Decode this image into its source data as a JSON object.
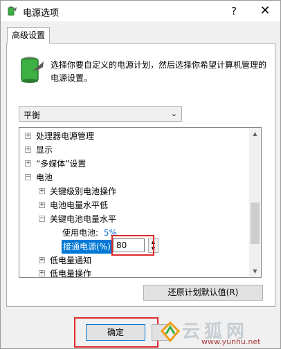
{
  "window": {
    "title": "电源选项",
    "help_label": "?",
    "close_label": "✕"
  },
  "tab": {
    "label": "高级设置"
  },
  "description": "选择你要自定义的电源计划，然后选择你希望计算机管理的电源设置。",
  "plan_select": {
    "value": "平衡"
  },
  "tree": {
    "items": [
      {
        "expander": "+",
        "label": "处理器电源管理"
      },
      {
        "expander": "+",
        "label": "显示"
      },
      {
        "expander": "+",
        "label": "“多媒体”设置"
      },
      {
        "expander": "−",
        "label": "电池"
      },
      {
        "expander": "+",
        "label": "关键级别电池操作"
      },
      {
        "expander": "+",
        "label": "电池电量水平低"
      },
      {
        "expander": "−",
        "label": "关键电池电量水平"
      },
      {
        "label": "使用电池:",
        "value": "5%"
      },
      {
        "label": "接通电源(%)"
      },
      {
        "expander": "+",
        "label": "低电量通知"
      },
      {
        "expander": "+",
        "label": "低电量操作"
      }
    ],
    "spin_value": "80"
  },
  "restore_button": "还原计划默认值(R)",
  "ok_button": "确定",
  "watermark": {
    "name": "云狐网",
    "url": "www.yunhu.net"
  },
  "colors": {
    "highlight": "#e0282b",
    "selection": "#0078d7",
    "battery": "#3cb043",
    "link_value": "#1a6fd1"
  }
}
